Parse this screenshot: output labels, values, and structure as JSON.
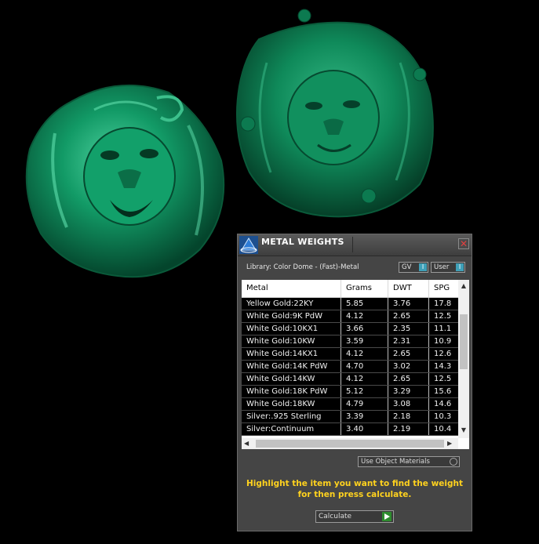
{
  "panel": {
    "title": "METAL WEIGHTS",
    "close_glyph": "✕",
    "library_label": "Library: Color Dome - (Fast)-Metal",
    "toggles": [
      {
        "label": "GV",
        "indicator": "I"
      },
      {
        "label": "User",
        "indicator": "I"
      }
    ]
  },
  "table": {
    "headers": [
      "Metal",
      "Grams",
      "DWT",
      "SPG"
    ],
    "rows": [
      [
        "Yellow Gold:22KY",
        "5.85",
        "3.76",
        "17.8"
      ],
      [
        "White Gold:9K PdW",
        "4.12",
        "2.65",
        "12.5"
      ],
      [
        "White Gold:10KX1",
        "3.66",
        "2.35",
        "11.1"
      ],
      [
        "White Gold:10KW",
        "3.59",
        "2.31",
        "10.9"
      ],
      [
        "White Gold:14KX1",
        "4.12",
        "2.65",
        "12.6"
      ],
      [
        "White Gold:14K PdW",
        "4.70",
        "3.02",
        "14.3"
      ],
      [
        "White Gold:14KW",
        "4.12",
        "2.65",
        "12.5"
      ],
      [
        "White Gold:18K PdW",
        "5.12",
        "3.29",
        "15.6"
      ],
      [
        "White Gold:18KW",
        "4.79",
        "3.08",
        "14.6"
      ],
      [
        "Silver:.925 Sterling",
        "3.39",
        "2.18",
        "10.3"
      ],
      [
        "Silver:Continuum",
        "3.40",
        "2.19",
        "10.4"
      ]
    ]
  },
  "options": {
    "use_object_materials": "Use Object Materials"
  },
  "hint": "Highlight the item you want to find the weight for then press calculate.",
  "calculate_label": "Calculate",
  "icons": {
    "logo": "gemvision-pyramid-icon",
    "close": "close-icon",
    "play": "play-icon"
  },
  "colors": {
    "model_green": "#0f7f55",
    "hint_yellow": "#ffd21e",
    "panel_bg": "#454545"
  }
}
